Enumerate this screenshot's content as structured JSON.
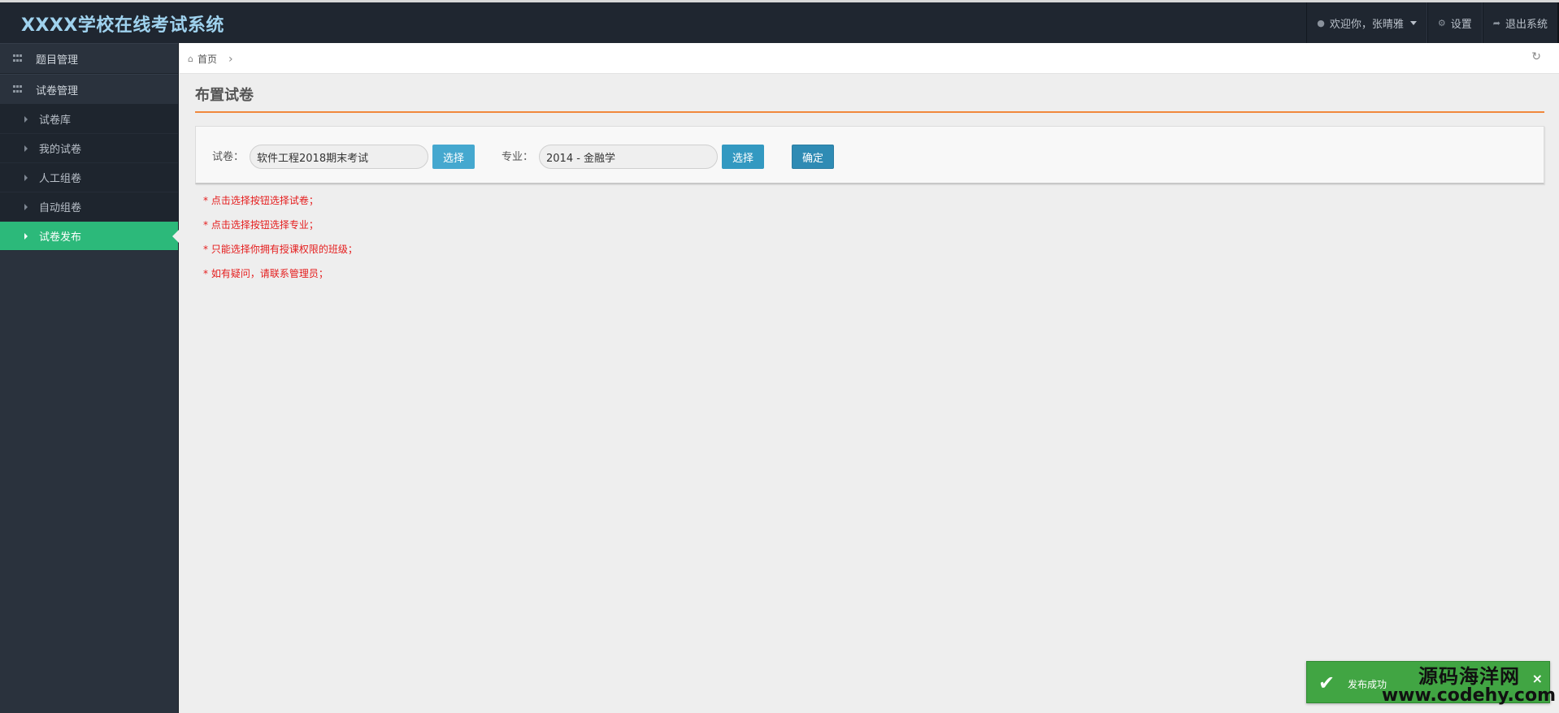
{
  "app": {
    "title": "XXXX学校在线考试系统"
  },
  "navbar": {
    "welcome": "欢迎你，张晴雅",
    "settings": "设置",
    "logout": "退出系统"
  },
  "sidebar": {
    "groups": [
      {
        "label": "题目管理"
      },
      {
        "label": "试卷管理"
      }
    ],
    "items": [
      {
        "label": "试卷库"
      },
      {
        "label": "我的试卷"
      },
      {
        "label": "人工组卷"
      },
      {
        "label": "自动组卷"
      },
      {
        "label": "试卷发布",
        "active": true
      }
    ]
  },
  "breadcrumb": {
    "home": "首页"
  },
  "page": {
    "title": "布置试卷"
  },
  "form": {
    "paper_label": "试卷：",
    "paper_value": "软件工程2018期末考试",
    "choose_label": "选择",
    "major_label": "专业：",
    "major_value": "2014 - 金融学",
    "confirm_label": "确定"
  },
  "tips": [
    "* 点击选择按钮选择试卷；",
    "* 点击选择按钮选择专业；",
    "* 只能选择你拥有授课权限的班级；",
    "* 如有疑问，请联系管理员；"
  ],
  "toast": {
    "message": "发布成功",
    "close": "×"
  },
  "watermark": {
    "name": "源码海洋网",
    "url": "www.codehy.com"
  },
  "colors": {
    "navbar": "#1f2630",
    "sidebar": "#2a323d",
    "active": "#2cb97a",
    "accent_rule": "#f0883c",
    "tip_red": "#e51d1d",
    "toast_green": "#41a543",
    "button_blue": "#45a8cf"
  },
  "icons": {
    "user": "user-icon",
    "settings": "gear-icon",
    "logout": "share-icon",
    "home": "home-icon",
    "refresh": "refresh-icon",
    "check": "check-icon",
    "close": "close-icon"
  }
}
